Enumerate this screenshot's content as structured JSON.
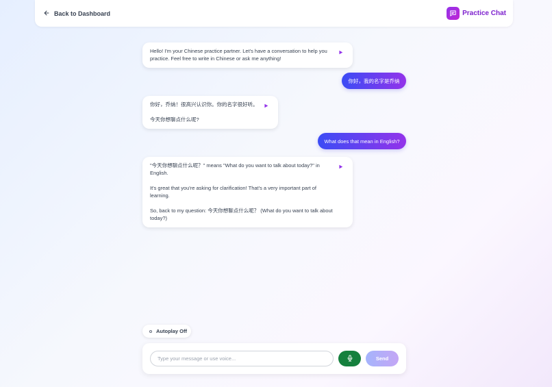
{
  "header": {
    "back_label": "Back to Dashboard",
    "brand_title": "Practice Chat"
  },
  "messages": [
    {
      "role": "bot",
      "paragraphs": [
        "Hello! I'm your Chinese practice partner. Let's have a conversation to help you practice. Feel free to write in Chinese or ask me anything!"
      ]
    },
    {
      "role": "user",
      "text": "你好，我的名字是乔纳"
    },
    {
      "role": "bot",
      "paragraphs": [
        "你好，乔纳！很高兴认识你。你的名字很好听。",
        "今天你想聊点什么呢?"
      ]
    },
    {
      "role": "user",
      "text": "What does that mean in English?"
    },
    {
      "role": "bot",
      "paragraphs": [
        "\"今天你想聊点什么呢？\" means \"What do you want to talk about today?\" in English.",
        "It's great that you're asking for clarification! That's a very important part of learning.",
        "So, back to my question: 今天你想聊点什么呢？ (What do you want to talk about today?)"
      ]
    }
  ],
  "controls": {
    "autoplay_label": "Autoplay Off",
    "input_placeholder": "Type your message or use voice...",
    "input_value": "",
    "send_label": "Send"
  },
  "colors": {
    "accent": "#9333ea",
    "user_bubble_start": "#3b4cf5",
    "user_bubble_end": "#9333ea",
    "mic": "#15803d"
  }
}
